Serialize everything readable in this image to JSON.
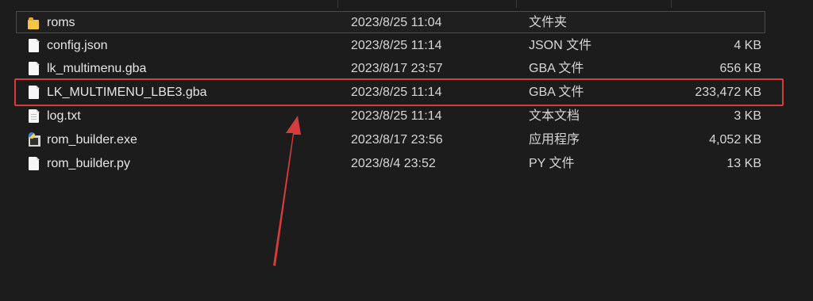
{
  "files": [
    {
      "name": "roms",
      "date": "2023/8/25 11:04",
      "type": "文件夹",
      "size": "",
      "icon": "folder-icon"
    },
    {
      "name": "config.json",
      "date": "2023/8/25 11:14",
      "type": "JSON 文件",
      "size": "4 KB",
      "icon": "file-icon"
    },
    {
      "name": "lk_multimenu.gba",
      "date": "2023/8/17 23:57",
      "type": "GBA 文件",
      "size": "656 KB",
      "icon": "file-icon"
    },
    {
      "name": "LK_MULTIMENU_LBE3.gba",
      "date": "2023/8/25 11:14",
      "type": "GBA 文件",
      "size": "233,472 KB",
      "icon": "file-icon"
    },
    {
      "name": "log.txt",
      "date": "2023/8/25 11:14",
      "type": "文本文档",
      "size": "3 KB",
      "icon": "text-file-icon"
    },
    {
      "name": "rom_builder.exe",
      "date": "2023/8/17 23:56",
      "type": "应用程序",
      "size": "4,052 KB",
      "icon": "exe-icon"
    },
    {
      "name": "rom_builder.py",
      "date": "2023/8/4 23:52",
      "type": "PY 文件",
      "size": "13 KB",
      "icon": "file-icon"
    }
  ],
  "colors": {
    "background": "#1c1c1c",
    "text": "#e6e6e6",
    "highlight": "#d73b3b",
    "folder": "#f6c544"
  }
}
